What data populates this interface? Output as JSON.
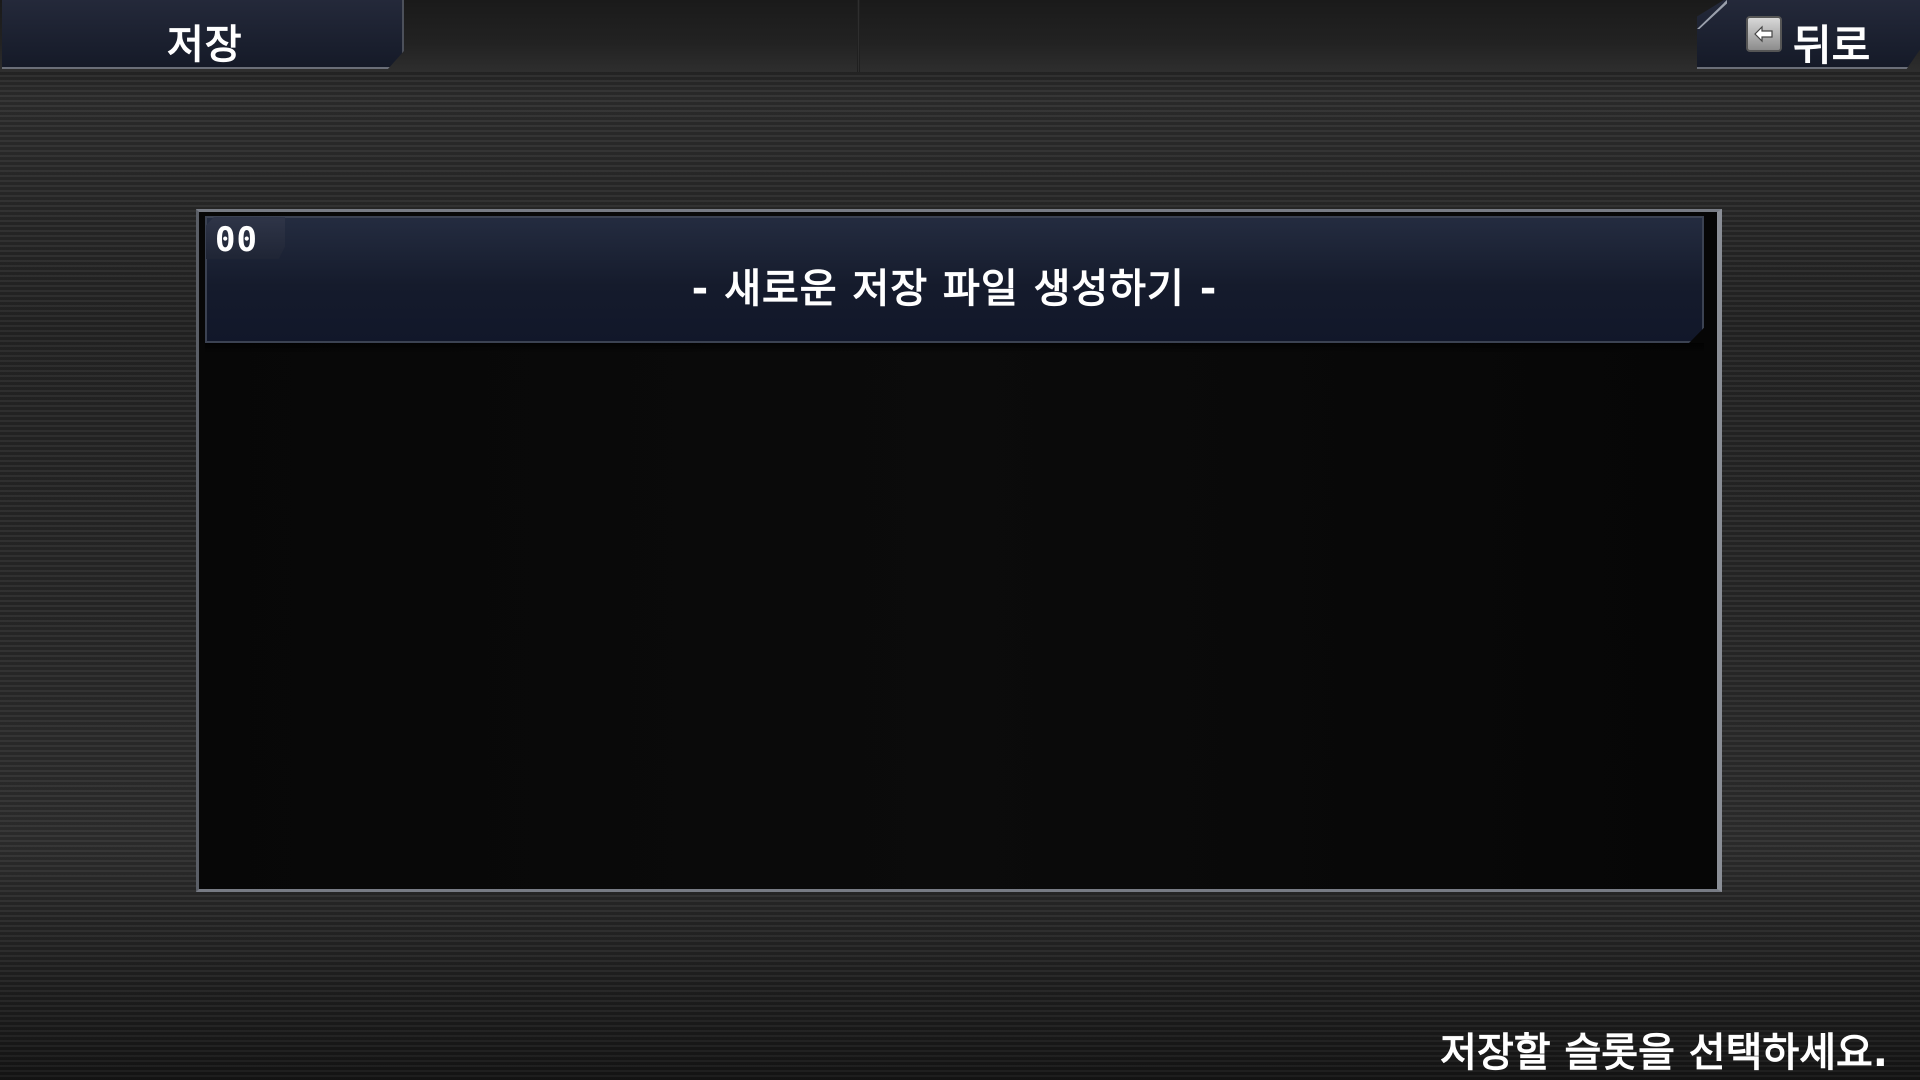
{
  "header": {
    "title": "저장",
    "back_label": "뒤로",
    "back_icon": "back-arrow-icon"
  },
  "slots": [
    {
      "number": "00",
      "label": "- 새로운 저장 파일 생성하기 -"
    }
  ],
  "footer": {
    "hint": "저장할 슬롯을 선택하세요."
  },
  "colors": {
    "tab_background": "#1b2030",
    "panel_background": "#080808",
    "border": "#777b84",
    "text": "#ffffff"
  }
}
